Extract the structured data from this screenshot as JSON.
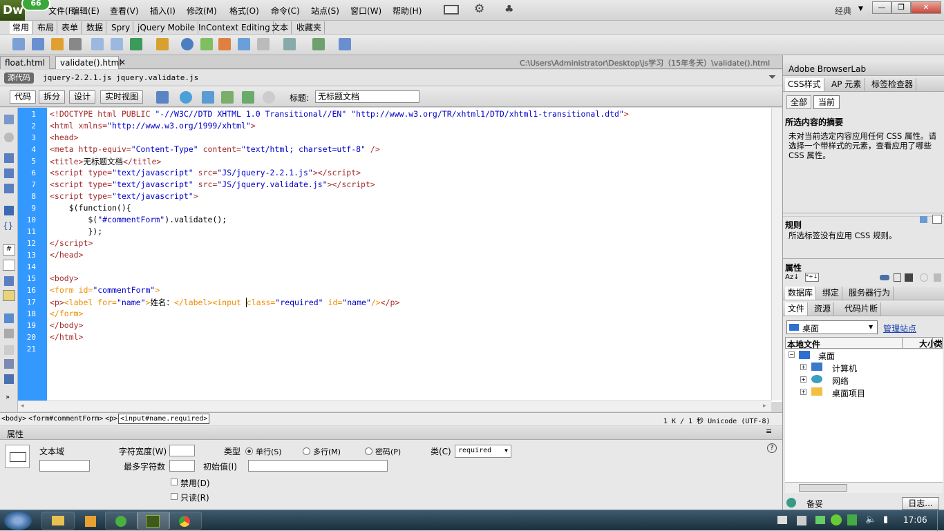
{
  "app": {
    "logo": "Dw",
    "badge": "66",
    "menus": [
      "文件(F)",
      "编辑(E)",
      "查看(V)",
      "插入(I)",
      "修改(M)",
      "格式(O)",
      "命令(C)",
      "站点(S)",
      "窗口(W)",
      "帮助(H)"
    ],
    "workspace": "经典",
    "win_min": "—",
    "win_max": "❐",
    "win_close": "✕"
  },
  "insert_tabs": [
    "常用",
    "布局",
    "表单",
    "数据",
    "Spry",
    "jQuery Mobile",
    "InContext Editing",
    "文本",
    "收藏夹"
  ],
  "doc_tabs": [
    "float.html",
    "validate().html"
  ],
  "doc_close": "×",
  "doc_path": "C:\\Users\\Administrator\\Desktop\\js学习（15年冬天）\\validate().html",
  "related": {
    "source": "源代码",
    "files": [
      "jquery-2.2.1.js",
      "jquery.validate.js"
    ]
  },
  "view_buttons": [
    "代码",
    "拆分",
    "设计",
    "实时视图"
  ],
  "title_label": "标题:",
  "title_value": "无标题文档",
  "line_numbers": [
    "1",
    "2",
    "3",
    "4",
    "5",
    "6",
    "7",
    "8",
    "9",
    "10",
    "11",
    "12",
    "13",
    "14",
    "15",
    "16",
    "17",
    "18",
    "19",
    "20",
    "21"
  ],
  "tag_selector": [
    "<body>",
    "<form#commentForm>",
    "<p>",
    "<input#name.required>"
  ],
  "status_right": "1 K / 1 秒  Unicode (UTF-8)",
  "properties": {
    "header": "属性",
    "type_name": "文本域",
    "char_width": "字符宽度(W)",
    "max_chars": "最多字符数",
    "type_label": "类型",
    "type_single": "单行(S)",
    "type_multi": "多行(M)",
    "type_password": "密码(P)",
    "init_value": "初始值(I)",
    "class_label": "类(C)",
    "class_value": "required",
    "disabled": "禁用(D)",
    "readonly": "只读(R)",
    "help": "?"
  },
  "right": {
    "browserlab": "Adobe BrowserLab",
    "css_tabs": [
      "CSS样式",
      "AP 元素",
      "标签检查器"
    ],
    "mode_all": "全部",
    "mode_current": "当前",
    "summary_title": "所选内容的摘要",
    "summary_text": "未对当前选定内容应用任何 CSS 属性。请选择一个带样式的元素，查看应用了哪些 CSS 属性。",
    "rules_title": "规则",
    "rules_text": "所选标签没有应用 CSS 规则。",
    "props_title": "属性",
    "db_tabs": [
      "数据库",
      "绑定",
      "服务器行为"
    ],
    "file_tabs": [
      "文件",
      "资源",
      "代码片断"
    ],
    "site_select": "桌面",
    "manage_site": "管理站点",
    "file_cols": [
      "本地文件",
      "大小",
      "类型"
    ],
    "tree": [
      "桌面",
      "计算机",
      "网络",
      "桌面项目"
    ],
    "ready": "备妥",
    "log": "日志..."
  },
  "taskbar": {
    "clock": "17:06"
  }
}
